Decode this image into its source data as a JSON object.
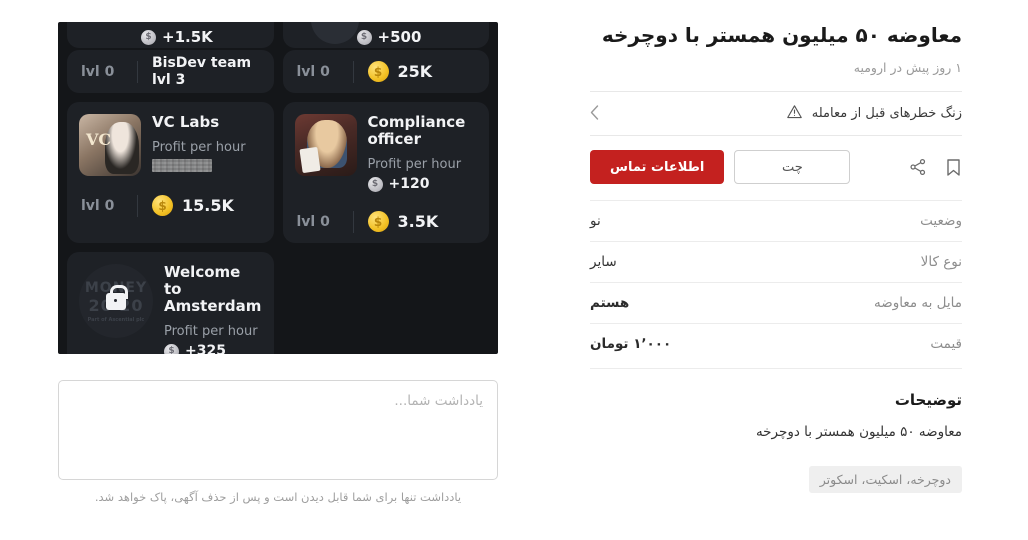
{
  "listing": {
    "title": "معاوضه ۵۰ میلیون همستر با دوچرخه",
    "meta": "۱ روز پیش در ارومیه",
    "warning_text": "زنگ خطرهای قبل از معامله",
    "warning_icon": "alert-triangle-icon",
    "chevron_icon": "chevron-left-icon",
    "actions": {
      "contact_label": "اطلاعات تماس",
      "chat_label": "چت",
      "share_icon": "share-icon",
      "bookmark_icon": "bookmark-icon"
    },
    "accent_color": "#c4211f",
    "specs": [
      {
        "key": "وضعیت",
        "value": "نو",
        "bold": false
      },
      {
        "key": "نوع کالا",
        "value": "سایر",
        "bold": false
      },
      {
        "key": "مایل به معاوضه",
        "value": "هستم",
        "bold": true
      },
      {
        "key": "قیمت",
        "value": "۱٬۰۰۰ تومان",
        "bold": true
      }
    ],
    "description": {
      "heading": "توضیحات",
      "body": "معاوضه ۵۰ میلیون همستر با دوچرخه"
    },
    "tags": [
      "دوچرخه، اسکیت، اسکوتر"
    ]
  },
  "note": {
    "placeholder": "یادداشت شما...",
    "hint": "یادداشت تنها برای شما قابل دیدن است و پس از حذف آگهی، پاک خواهد شد."
  },
  "game_image": {
    "cut_row": [
      {
        "coin_icon": "silver-coin-icon",
        "value": "+500"
      },
      {
        "coin_icon": "silver-coin-icon",
        "value": "+1.5K"
      }
    ],
    "stat_row": [
      {
        "lvl": "lvl 0",
        "team_name": "BisDev team",
        "team_lvl": "lvl 3"
      },
      {
        "lvl": "lvl 0",
        "coin_icon": "gold-coin-icon",
        "value": "25K"
      }
    ],
    "cards": [
      {
        "name": "VC Labs",
        "profit_label": "Profit per hour",
        "profit_value": "",
        "profit_blurred": true,
        "lvl": "lvl 0",
        "coin_icon": "gold-coin-icon",
        "cost": "15.5K",
        "thumb_icon": "vc-labs-avatar",
        "locked": false
      },
      {
        "name": "Compliance officer",
        "profit_label": "Profit per hour",
        "profit_value": "+120",
        "profit_blurred": false,
        "lvl": "lvl 0",
        "coin_icon": "gold-coin-icon",
        "cost": "3.5K",
        "thumb_icon": "compliance-officer-avatar",
        "locked": false
      },
      {
        "name": "Welcome to Amsterdam",
        "profit_label": "Profit per hour",
        "profit_value": "+325",
        "profit_blurred": false,
        "lvl": "",
        "coin_icon": "silver-coin-icon",
        "cost": "",
        "thumb_icon": "lock-icon",
        "locked": true,
        "logo_line1": "MONEY",
        "logo_line2": "20 20",
        "logo_line3": "Part of Ascential plc"
      }
    ]
  }
}
